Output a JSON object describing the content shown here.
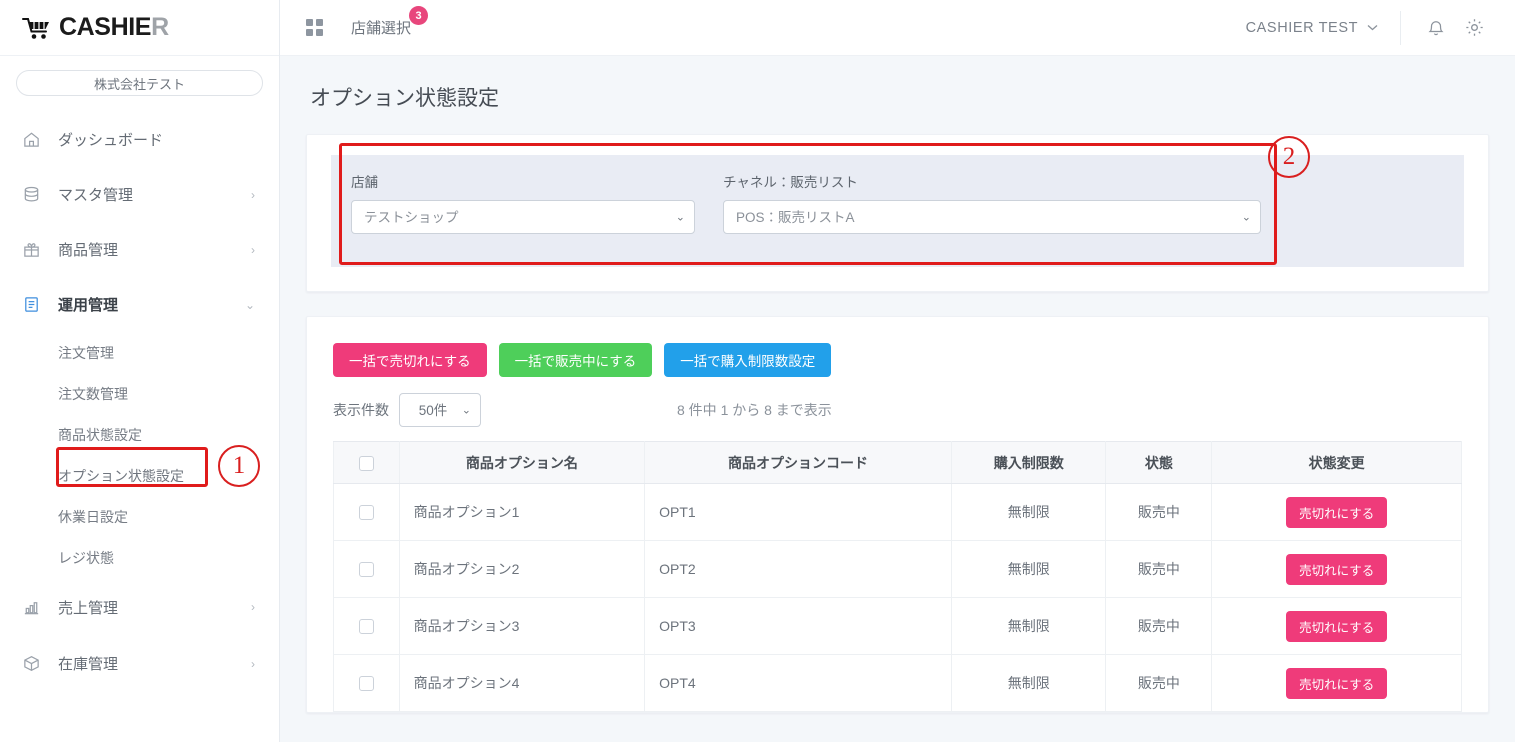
{
  "brand": {
    "name_main": "CASHIE",
    "name_accent": "R",
    "cart_icon": "shopping-cart-icon"
  },
  "sidebar": {
    "company": "株式会社テスト",
    "items": [
      {
        "label": "ダッシュボード",
        "icon": "home-icon",
        "chevron": "",
        "active": false
      },
      {
        "label": "マスタ管理",
        "icon": "database-icon",
        "chevron": "›",
        "active": false
      },
      {
        "label": "商品管理",
        "icon": "gift-icon",
        "chevron": "›",
        "active": false
      },
      {
        "label": "運用管理",
        "icon": "clipboard-icon",
        "chevron": "⌄",
        "active": true
      }
    ],
    "sub_items": [
      {
        "label": "注文管理"
      },
      {
        "label": "注文数管理"
      },
      {
        "label": "商品状態設定"
      },
      {
        "label": "オプション状態設定"
      },
      {
        "label": "休業日設定"
      },
      {
        "label": "レジ状態"
      }
    ],
    "items_bottom": [
      {
        "label": "売上管理",
        "icon": "bar-chart-icon",
        "chevron": "›"
      },
      {
        "label": "在庫管理",
        "icon": "box-icon",
        "chevron": "›"
      }
    ]
  },
  "topbar": {
    "grid_icon": "apps-grid-icon",
    "store_select_label": "店舗選択",
    "store_badge": "3",
    "user_name": "CASHIER TEST",
    "user_chevron": "⌄",
    "bell_icon": "bell-icon",
    "gear_icon": "gear-icon"
  },
  "page": {
    "title": "オプション状態設定"
  },
  "filter": {
    "store": {
      "label": "店舗",
      "value": "テストショップ"
    },
    "channel": {
      "label": "チャネル：販売リスト",
      "value": "POS：販売リストA"
    }
  },
  "actions": {
    "bulk_soldout": "一括で売切れにする",
    "bulk_onsale": "一括で販売中にする",
    "bulk_limit": "一括で購入制限数設定"
  },
  "list_controls": {
    "per_page_label": "表示件数",
    "per_page_value": "50件",
    "pager_text": "8 件中 1 から 8 まで表示"
  },
  "table": {
    "headers": [
      "",
      "商品オプション名",
      "商品オプションコード",
      "購入制限数",
      "状態",
      "状態変更"
    ],
    "rows": [
      {
        "name": "商品オプション1",
        "code": "OPT1",
        "limit": "無制限",
        "state": "販売中",
        "action": "売切れにする"
      },
      {
        "name": "商品オプション2",
        "code": "OPT2",
        "limit": "無制限",
        "state": "販売中",
        "action": "売切れにする"
      },
      {
        "name": "商品オプション3",
        "code": "OPT3",
        "limit": "無制限",
        "state": "販売中",
        "action": "売切れにする"
      },
      {
        "name": "商品オプション4",
        "code": "OPT4",
        "limit": "無制限",
        "state": "販売中",
        "action": "売切れにする"
      }
    ]
  },
  "annotations": [
    {
      "id": "1",
      "label": "①"
    },
    {
      "id": "2",
      "label": "②"
    }
  ],
  "colors": {
    "accent_pink": "#ef3b7a",
    "accent_green": "#4ecf5a",
    "accent_blue": "#22a0ea",
    "badge_pink": "#e8467c",
    "annotation_red": "#e01b1b",
    "panel_bg": "#e9ecf4"
  }
}
